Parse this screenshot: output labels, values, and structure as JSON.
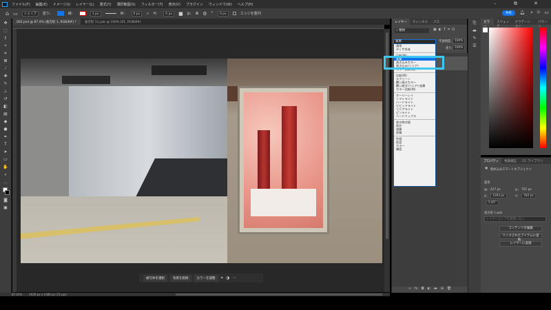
{
  "menu": [
    "ファイル(F)",
    "編集(E)",
    "イメージ(I)",
    "レイヤー(L)",
    "書式(Y)",
    "選択範囲(S)",
    "フィルター(T)",
    "表示(V)",
    "プラグイン",
    "ウィンドウ(W)",
    "ヘルプ(H)"
  ],
  "window_controls": {
    "minimize": "–",
    "restore": "⧉",
    "close": "✕"
  },
  "options": {
    "mode": "シェイプ",
    "fill_label": "塗り：",
    "stroke_label": "線：",
    "stroke_width": "1 px",
    "w_label": "W：",
    "w_value": "0 px",
    "h_label": "H：",
    "h_value": "0 px",
    "radius": "0 px",
    "align_edges": "エッジを整列",
    "fill_color": "#1473e6",
    "share": "共有"
  },
  "tabs": [
    "002.psd @ 87.4% (長方形 1, RGB/8#) *",
    "長方形 11.psb @ 100% (01, RGB/8#)"
  ],
  "layers_panel": {
    "tabs": [
      "レイヤー",
      "チャンネル",
      "パス"
    ],
    "filter": "種類",
    "blend_mode": "乗算",
    "opacity_label": "不透明度：",
    "opacity": "100%",
    "fill_label": "塗り：",
    "fill": "100%"
  },
  "blend_groups": [
    [
      "通常",
      "ディザ合成"
    ],
    [
      "比較(暗)",
      "乗算",
      "焼き込みカラー",
      "焼き込み(リニア)",
      "カラー比較(暗)"
    ],
    [
      "比較(明)",
      "スクリーン",
      "覆い焼きカラー",
      "覆い焼き(リニア)-加算",
      "カラー比較(明)"
    ],
    [
      "オーバーレイ",
      "ソフトライト",
      "ハードライト",
      "ビビッドライト",
      "リニアライト",
      "ピンライト",
      "ハードミックス"
    ],
    [
      "差の絶対値",
      "除外",
      "減算",
      "除算"
    ],
    [
      "色相",
      "彩度",
      "カラー",
      "輝度"
    ]
  ],
  "selected_blend": "乗算",
  "color_panel": {
    "tabs": [
      "カラー",
      "スウォッチ",
      "グラデーション",
      "パターン"
    ]
  },
  "properties": {
    "tabs": [
      "プロパティ",
      "色調補正",
      "CC ライブラリ"
    ],
    "type": "埋め込みスマートオブジェクト",
    "section": "変形",
    "w_label": "W：",
    "w": "427 px",
    "h_label": "H：",
    "h": "701 px",
    "x_label": "X：",
    "x": "1283 px",
    "y_label": "Y：",
    "y": "184 px",
    "angle": "5.85°",
    "file": "長方形 1.psb",
    "comp": "レイヤーカンプを適用しない",
    "buttons": [
      "コンテンツを編集",
      "リンクされたアイテムに変換...",
      "レイヤーに変換"
    ]
  },
  "context_bar": [
    "被写体を選択",
    "背景を削除",
    "カラーを調整"
  ],
  "status": {
    "zoom": "87.41%",
    "doc": "1920 px x 1080 px (72 ppi)"
  }
}
